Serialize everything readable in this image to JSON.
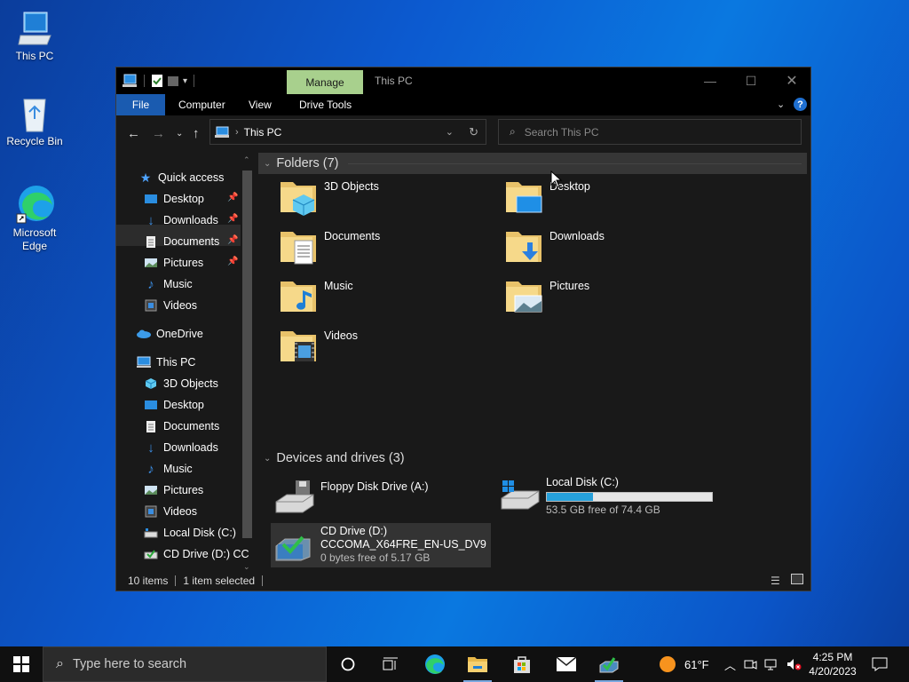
{
  "desktop": {
    "icons": [
      {
        "label": "This PC"
      },
      {
        "label": "Recycle Bin"
      },
      {
        "label": "Microsoft Edge"
      }
    ]
  },
  "window": {
    "context_tab": "Manage",
    "title": "This PC",
    "ribbon_tabs": {
      "file": "File",
      "computer": "Computer",
      "view": "View",
      "drive_tools": "Drive Tools"
    },
    "help": "?",
    "address": "This PC",
    "search_placeholder": "Search This PC"
  },
  "nav": {
    "quick_access": "Quick access",
    "quick_items": [
      {
        "label": "Desktop",
        "icon": "desktop-icon"
      },
      {
        "label": "Downloads",
        "icon": "downloads-icon"
      },
      {
        "label": "Documents",
        "icon": "documents-icon"
      },
      {
        "label": "Pictures",
        "icon": "pictures-icon"
      },
      {
        "label": "Music",
        "icon": "music-icon"
      },
      {
        "label": "Videos",
        "icon": "videos-icon"
      }
    ],
    "onedrive": "OneDrive",
    "this_pc": "This PC",
    "pc_items": [
      {
        "label": "3D Objects"
      },
      {
        "label": "Desktop"
      },
      {
        "label": "Documents"
      },
      {
        "label": "Downloads"
      },
      {
        "label": "Music"
      },
      {
        "label": "Pictures"
      },
      {
        "label": "Videos"
      },
      {
        "label": "Local Disk (C:)"
      },
      {
        "label": "CD Drive (D:) CC"
      }
    ]
  },
  "content": {
    "folders_header": "Folders (7)",
    "folders": [
      {
        "label": "3D Objects"
      },
      {
        "label": "Desktop"
      },
      {
        "label": "Documents"
      },
      {
        "label": "Downloads"
      },
      {
        "label": "Music"
      },
      {
        "label": "Pictures"
      },
      {
        "label": "Videos"
      }
    ],
    "devices_header": "Devices and drives (3)",
    "drives": {
      "floppy": {
        "label": "Floppy Disk Drive (A:)"
      },
      "local": {
        "label": "Local Disk (C:)",
        "free_text": "53.5 GB free of 74.4 GB",
        "used_fraction": 0.28
      },
      "cd": {
        "label": "CD Drive (D:)",
        "volume": "CCCOMA_X64FRE_EN-US_DV9",
        "free_text": "0 bytes free of 5.17 GB"
      }
    }
  },
  "status": {
    "items": "10 items",
    "selected": "1 item selected"
  },
  "taskbar": {
    "search_placeholder": "Type here to search",
    "weather": "61°F",
    "time": "4:25 PM",
    "date": "4/20/2023"
  },
  "colors": {
    "accent": "#1a5bb0",
    "manage_tab": "#a8d08d",
    "usage_bar": "#26a0da"
  }
}
